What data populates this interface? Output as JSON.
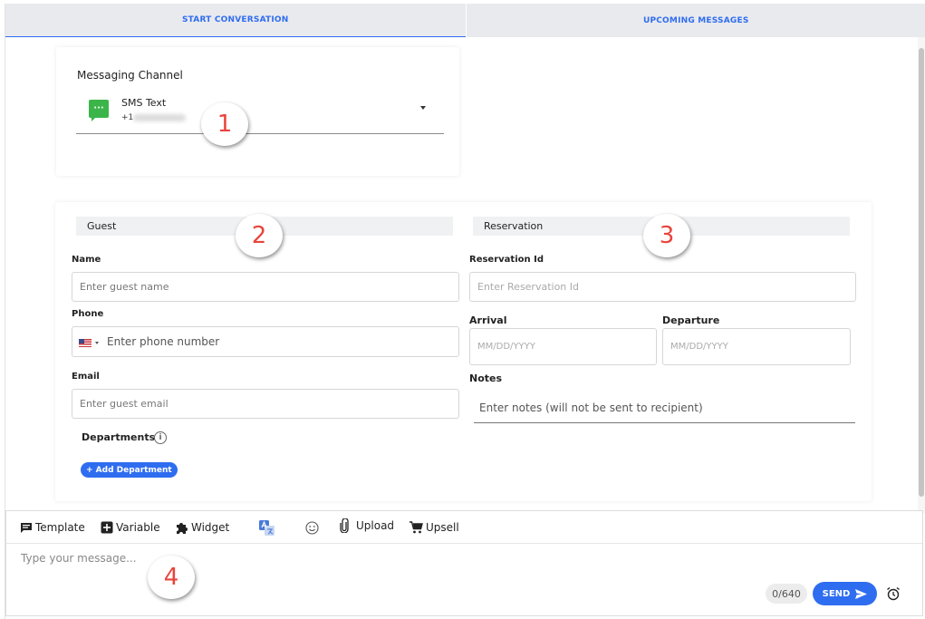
{
  "tabs": [
    {
      "label": "START CONVERSATION",
      "active": true
    },
    {
      "label": "UPCOMING MESSAGES",
      "active": false
    }
  ],
  "channel": {
    "label": "Messaging Channel",
    "selected_name": "SMS Text",
    "number_prefix": "+1",
    "icon": "chat-bubble-icon"
  },
  "guest": {
    "section_title": "Guest",
    "name_label": "Name",
    "name_placeholder": "Enter guest name",
    "phone_label": "Phone",
    "phone_placeholder": "Enter phone number",
    "email_label": "Email",
    "email_placeholder": "Enter guest email",
    "departments_label": "Departments",
    "add_department_label": "+ Add Department"
  },
  "reservation": {
    "section_title": "Reservation",
    "id_label": "Reservation Id",
    "id_placeholder": "Enter Reservation Id",
    "arrival_label": "Arrival",
    "arrival_placeholder": "MM/DD/YYYY",
    "departure_label": "Departure",
    "departure_placeholder": "MM/DD/YYYY",
    "notes_label": "Notes",
    "notes_placeholder": "Enter notes (will not be sent to recipient)"
  },
  "composer": {
    "tools": {
      "template": "Template",
      "variable": "Variable",
      "widget": "Widget",
      "upload": "Upload",
      "upsell": "Upsell"
    },
    "message_placeholder": "Type your message...",
    "counter": "0/640",
    "send_label": "SEND"
  },
  "badges": [
    "1",
    "2",
    "3",
    "4"
  ],
  "colors": {
    "accent": "#2f6df0",
    "sms_green": "#3bb54a",
    "badge_number": "#e8453c"
  }
}
